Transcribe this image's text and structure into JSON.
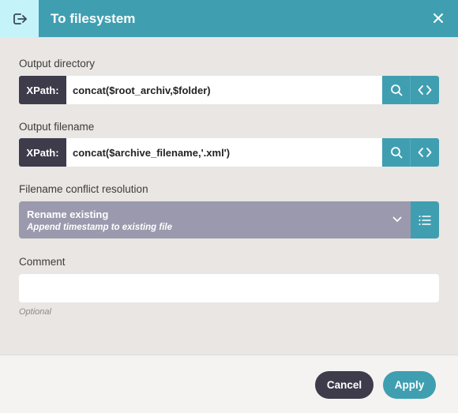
{
  "dialog": {
    "title": "To filesystem",
    "header_icon": "export-icon",
    "close_icon": "close-icon"
  },
  "output_directory": {
    "label": "Output directory",
    "tag": "XPath:",
    "value": "concat($root_archiv,$folder)",
    "search_icon": "search-icon",
    "code_icon": "code-icon"
  },
  "output_filename": {
    "label": "Output filename",
    "tag": "XPath:",
    "value": "concat($archive_filename,'.xml')",
    "search_icon": "search-icon",
    "code_icon": "code-icon"
  },
  "conflict_resolution": {
    "label": "Filename conflict resolution",
    "selected_primary": "Rename existing",
    "selected_secondary": "Append timestamp to existing file",
    "chevron_icon": "chevron-down-icon",
    "list_icon": "list-icon"
  },
  "comment": {
    "label": "Comment",
    "value": "",
    "helper": "Optional"
  },
  "footer": {
    "cancel_label": "Cancel",
    "apply_label": "Apply"
  },
  "colors": {
    "accent": "#3f9fb1",
    "dark": "#3e3b4b",
    "select_bg": "#9b99ad",
    "header_tile": "#c5f3fa",
    "background": "#e9e6e3"
  }
}
